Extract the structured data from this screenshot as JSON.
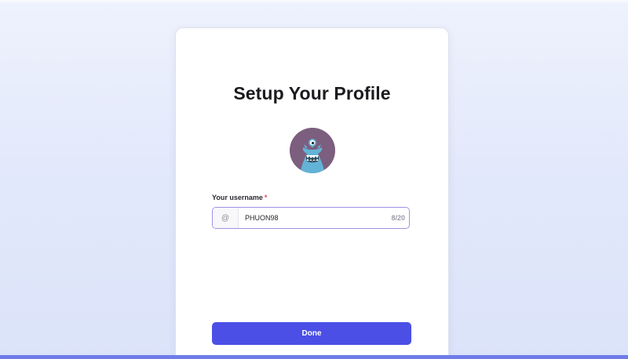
{
  "page": {
    "title": "Setup Your Profile"
  },
  "avatar": {
    "icon": "blue-monster-avatar",
    "background_color": "#7c5e7e",
    "figure_color": "#63b3d6"
  },
  "form": {
    "username_label": "Your username",
    "required_marker": "*",
    "prefix": "@",
    "username_value": "PHUON98",
    "char_count": "8/20"
  },
  "actions": {
    "done_label": "Done"
  },
  "colors": {
    "primary_button": "#4b4fe6",
    "input_focus_border": "#9c94e6",
    "required": "#e5484d",
    "background": "#e3e9fb"
  }
}
